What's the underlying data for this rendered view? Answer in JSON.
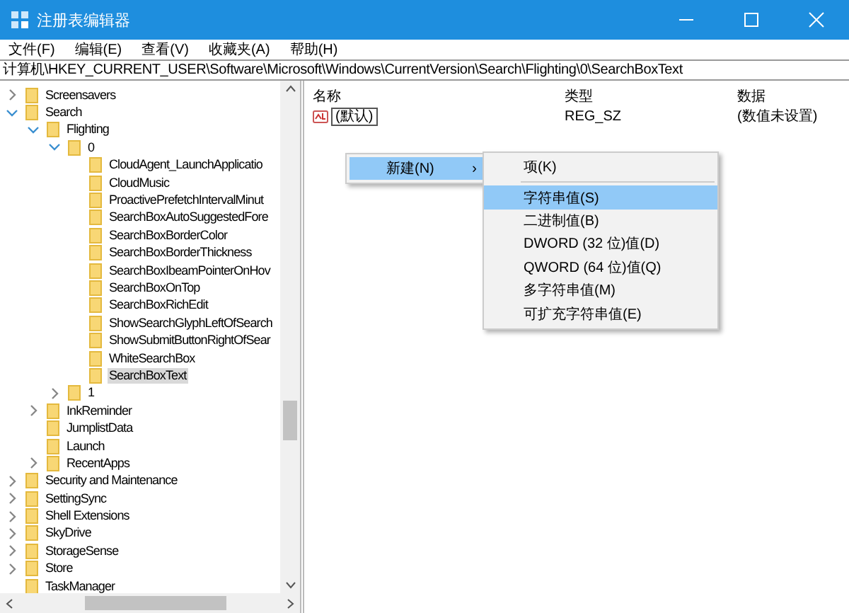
{
  "window": {
    "title": "注册表编辑器"
  },
  "menu": [
    "文件(F)",
    "编辑(E)",
    "查看(V)",
    "收藏夹(A)",
    "帮助(H)"
  ],
  "address": "计算机\\HKEY_CURRENT_USER\\Software\\Microsoft\\Windows\\CurrentVersion\\Search\\Flighting\\0\\SearchBoxText",
  "tree": [
    {
      "label": "Screensavers",
      "kind": "branch",
      "expanded": false,
      "selected": false
    },
    {
      "label": "Search",
      "kind": "branch",
      "expanded": true,
      "selected": false,
      "children": [
        {
          "label": "Flighting",
          "kind": "branch",
          "expanded": true,
          "selected": false,
          "children": [
            {
              "label": "0",
              "kind": "branch",
              "expanded": true,
              "selected": false,
              "children": [
                {
                  "label": "CloudAgent_LaunchApplicatio",
                  "kind": "leaf",
                  "selected": false
                },
                {
                  "label": "CloudMusic",
                  "kind": "leaf",
                  "selected": false
                },
                {
                  "label": "ProactivePrefetchIntervalMinut",
                  "kind": "leaf",
                  "selected": false
                },
                {
                  "label": "SearchBoxAutoSuggestedFore",
                  "kind": "leaf",
                  "selected": false
                },
                {
                  "label": "SearchBoxBorderColor",
                  "kind": "leaf",
                  "selected": false
                },
                {
                  "label": "SearchBoxBorderThickness",
                  "kind": "leaf",
                  "selected": false
                },
                {
                  "label": "SearchBoxIbeamPointerOnHov",
                  "kind": "leaf",
                  "selected": false
                },
                {
                  "label": "SearchBoxOnTop",
                  "kind": "leaf",
                  "selected": false
                },
                {
                  "label": "SearchBoxRichEdit",
                  "kind": "leaf",
                  "selected": false
                },
                {
                  "label": "ShowSearchGlyphLeftOfSearch",
                  "kind": "leaf",
                  "selected": false
                },
                {
                  "label": "ShowSubmitButtonRightOfSear",
                  "kind": "leaf",
                  "selected": false
                },
                {
                  "label": "WhiteSearchBox",
                  "kind": "leaf",
                  "selected": false
                },
                {
                  "label": "SearchBoxText",
                  "kind": "leaf",
                  "selected": true
                }
              ]
            },
            {
              "label": "1",
              "kind": "branch",
              "expanded": false,
              "selected": false
            }
          ]
        },
        {
          "label": "InkReminder",
          "kind": "branch",
          "expanded": false,
          "selected": false
        },
        {
          "label": "JumplistData",
          "kind": "leaf",
          "selected": false
        },
        {
          "label": "Launch",
          "kind": "leaf",
          "selected": false
        },
        {
          "label": "RecentApps",
          "kind": "branch",
          "expanded": false,
          "selected": false
        }
      ]
    },
    {
      "label": "Security and Maintenance",
      "kind": "branch",
      "expanded": false,
      "selected": false
    },
    {
      "label": "SettingSync",
      "kind": "branch",
      "expanded": false,
      "selected": false
    },
    {
      "label": "Shell Extensions",
      "kind": "branch",
      "expanded": false,
      "selected": false
    },
    {
      "label": "SkyDrive",
      "kind": "branch",
      "expanded": false,
      "selected": false
    },
    {
      "label": "StorageSense",
      "kind": "branch",
      "expanded": false,
      "selected": false
    },
    {
      "label": "Store",
      "kind": "branch",
      "expanded": false,
      "selected": false
    },
    {
      "label": "TaskManager",
      "kind": "leaf",
      "selected": false
    }
  ],
  "values": {
    "columns": [
      "名称",
      "类型",
      "数据"
    ],
    "rows": [
      {
        "name": "(默认)",
        "type": "REG_SZ",
        "data": "(数值未设置)",
        "editing": true
      }
    ]
  },
  "context_menu": {
    "items": [
      {
        "label": "新建(N)",
        "submenu_arrow": "›",
        "selected": true
      }
    ]
  },
  "submenu": {
    "items": [
      {
        "kind": "item",
        "label": "项(K)",
        "selected": false
      },
      {
        "kind": "separator"
      },
      {
        "kind": "item",
        "label": "字符串值(S)",
        "selected": true
      },
      {
        "kind": "item",
        "label": "二进制值(B)",
        "selected": false
      },
      {
        "kind": "item",
        "label": "DWORD (32 位)值(D)",
        "selected": false
      },
      {
        "kind": "item",
        "label": "QWORD (64 位)值(Q)",
        "selected": false
      },
      {
        "kind": "item",
        "label": "多字符串值(M)",
        "selected": false
      },
      {
        "kind": "item",
        "label": "可扩充字符串值(E)",
        "selected": false
      }
    ]
  }
}
